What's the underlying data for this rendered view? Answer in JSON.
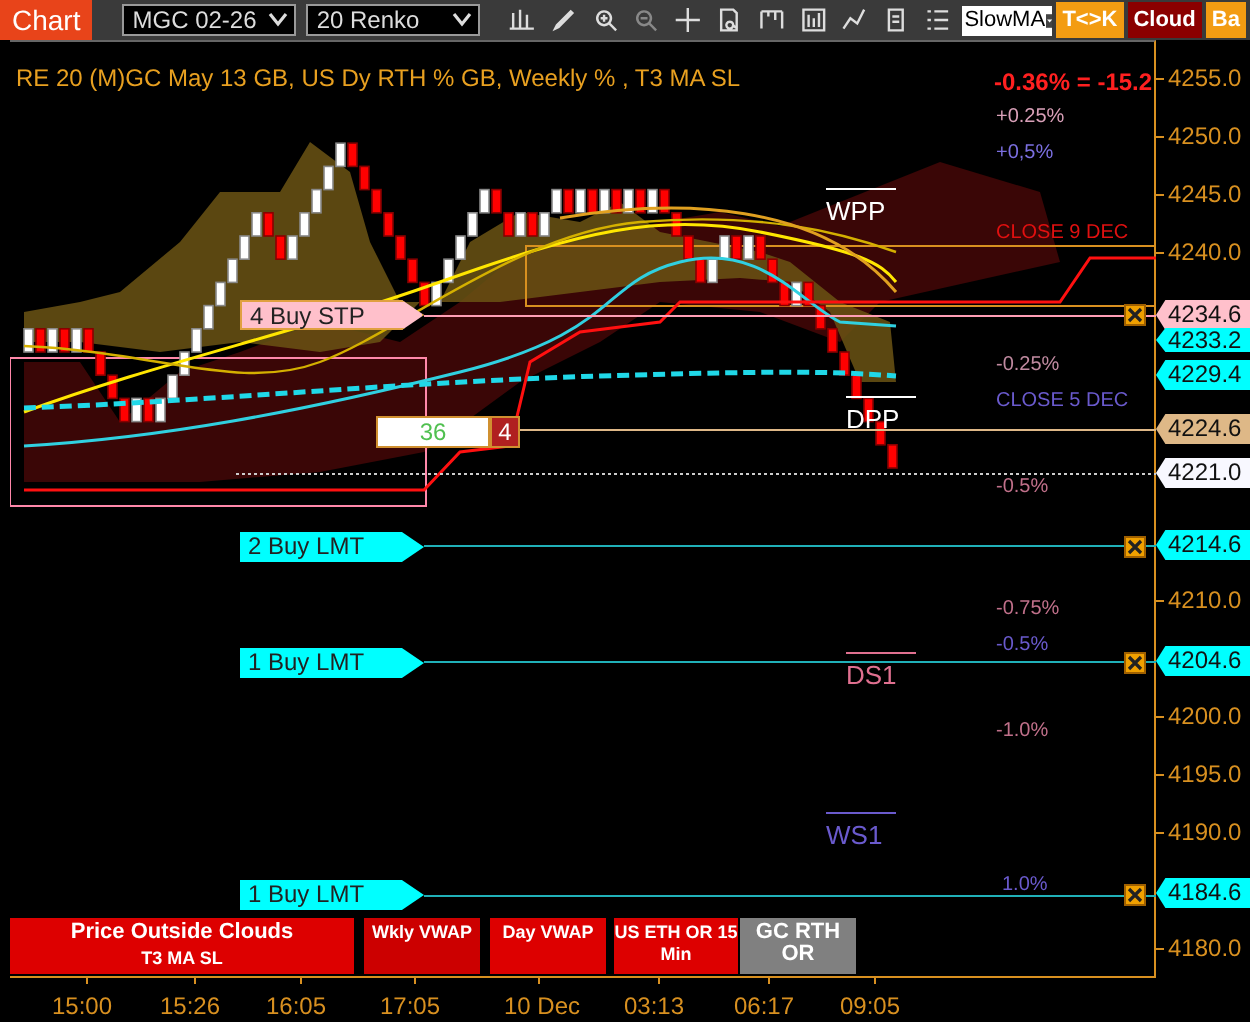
{
  "toolbar": {
    "chart_button": "Chart",
    "instrument": "MGC 02-26",
    "interval": "20 Renko",
    "indicator_select": "SlowMA",
    "buttons": [
      {
        "label": "T<>K",
        "color": "#f39c12"
      },
      {
        "label": "Cloud",
        "color": "#8b0000"
      },
      {
        "label": "Ba",
        "color": "#f39c12"
      }
    ]
  },
  "chart": {
    "title": "RE 20  (M)GC May 13 GB, US Dy RTH % GB, Weekly % , T3 MA SL",
    "change": "-0.36% = -15.2",
    "labels": [
      {
        "text": "+0.25%",
        "kind": "percent",
        "color": "#d9a0b8"
      },
      {
        "text": "+0,5%",
        "kind": "percent",
        "color": "#7b6fe0"
      },
      {
        "text": "WPP",
        "kind": "pivot",
        "color": "#ffffff"
      },
      {
        "text": "CLOSE 9 DEC",
        "kind": "percent",
        "color": "#e01010"
      },
      {
        "text": "-0.25%",
        "kind": "percent",
        "color": "#c08aa0"
      },
      {
        "text": "CLOSE 5 DEC",
        "kind": "percent",
        "color": "#6a5acd"
      },
      {
        "text": "DPP",
        "kind": "pivot",
        "color": "#ffffff"
      },
      {
        "text": "-0.5%",
        "kind": "percent",
        "color": "#c0708a"
      },
      {
        "text": "-0.75%",
        "kind": "percent",
        "color": "#c0708a"
      },
      {
        "text": "-0.5%",
        "kind": "percent",
        "color": "#6a5acd"
      },
      {
        "text": "DS1",
        "kind": "pivot",
        "color": "#e07090"
      },
      {
        "text": "-1.0%",
        "kind": "percent",
        "color": "#c0708a"
      },
      {
        "text": "WS1",
        "kind": "pivot",
        "color": "#6a5acd"
      },
      {
        "text": "1.0%",
        "kind": "percent",
        "color": "#6a5acd"
      }
    ],
    "orders": [
      {
        "text": "4 Buy STP",
        "kind": "stop"
      },
      {
        "text": "2 Buy LMT",
        "kind": "limit"
      },
      {
        "text": "1 Buy LMT",
        "kind": "limit"
      },
      {
        "text": "1 Buy LMT",
        "kind": "limit"
      }
    ],
    "position": {
      "quantity": "36",
      "count": "4"
    },
    "indicators": [
      {
        "text": "Price Outside Clouds",
        "sub": "T3 MA SL",
        "color": "#dd0000"
      },
      {
        "text": "Wkly VWAP",
        "color": "#cc0000"
      },
      {
        "text": "Day VWAP",
        "color": "#dd0000"
      },
      {
        "text": "US ETH OR 15 Min",
        "color": "#dd0000"
      },
      {
        "text": "GC RTH OR",
        "color": "#808080"
      }
    ]
  },
  "price_axis": {
    "ticks": [
      "4255.0",
      "4250.0",
      "4245.0",
      "4240.0",
      "4210.0",
      "4200.0",
      "4195.0",
      "4190.0",
      "4180.0"
    ],
    "markers": [
      {
        "text": "4234.6",
        "color": "#ffc0cb"
      },
      {
        "text": "4233.2",
        "color": "#00ffff"
      },
      {
        "text": "4229.4",
        "color": "#00ffff"
      },
      {
        "text": "4224.6",
        "color": "#deb887"
      },
      {
        "text": "4221.0",
        "color": "#f8f8ff"
      },
      {
        "text": "4214.6",
        "color": "#00ffff"
      },
      {
        "text": "4204.6",
        "color": "#00ffff"
      },
      {
        "text": "4184.6",
        "color": "#00ffff"
      }
    ]
  },
  "time_axis": [
    "15:00",
    "15:26",
    "16:05",
    "17:05",
    "10 Dec",
    "03:13",
    "06:17",
    "09:05"
  ]
}
